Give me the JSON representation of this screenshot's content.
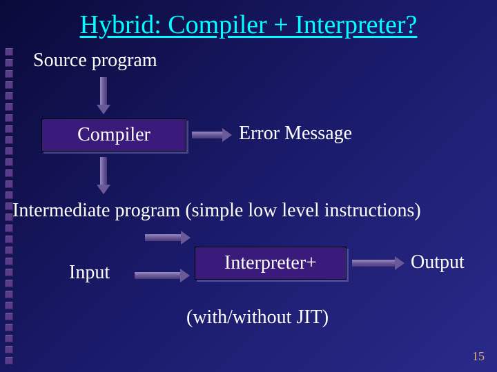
{
  "title": "Hybrid: Compiler + Interpreter?",
  "labels": {
    "source": "Source program",
    "error": "Error Message",
    "intermediate": "Intermediate program (simple low level instructions)",
    "input": "Input",
    "output": "Output",
    "jit_note": "(with/without JIT)"
  },
  "boxes": {
    "compiler": "Compiler",
    "interpreter": "Interpreter+"
  },
  "slide_number": "15"
}
